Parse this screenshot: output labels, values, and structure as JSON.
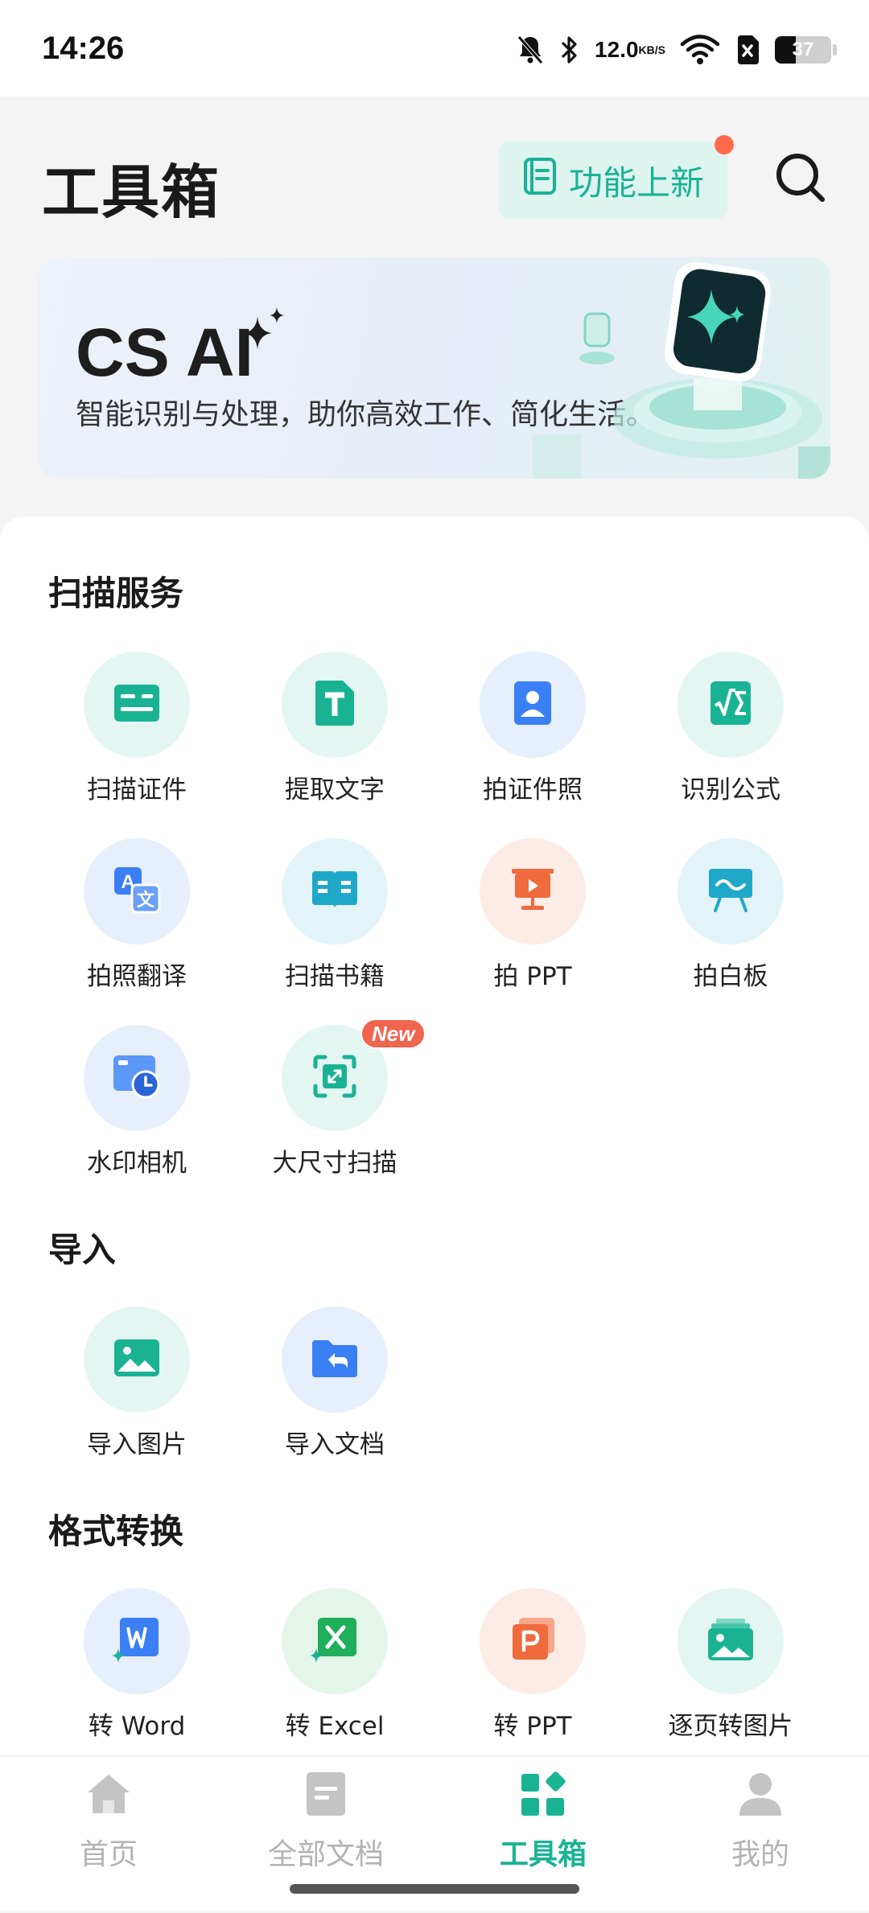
{
  "status_bar": {
    "time": "14:26",
    "net_speed_value": "12.0",
    "net_speed_unit": "KB/S",
    "battery_level": "37",
    "icons": [
      "mute-bell-icon",
      "bluetooth-icon",
      "wifi-icon",
      "sim-off-icon",
      "battery-icon"
    ]
  },
  "header": {
    "title": "工具箱",
    "new_feature_label": "功能上新",
    "search_icon": "search-icon"
  },
  "banner": {
    "title": "CS AI",
    "subtitle": "智能识别与处理，助你高效工作、简化生活。"
  },
  "sections": {
    "scan": {
      "title": "扫描服务",
      "items": [
        {
          "label": "扫描证件",
          "icon": "id-card-icon",
          "color": "#19b394",
          "bg": "#e4f6f2"
        },
        {
          "label": "提取文字",
          "icon": "text-extract-icon",
          "color": "#19b394",
          "bg": "#e4f6f2"
        },
        {
          "label": "拍证件照",
          "icon": "id-photo-icon",
          "color": "#3b7ff5",
          "bg": "#e7eefc"
        },
        {
          "label": "识别公式",
          "icon": "formula-icon",
          "color": "#19b394",
          "bg": "#e4f6f2"
        },
        {
          "label": "拍照翻译",
          "icon": "translate-icon",
          "color": "#3b7ff5",
          "bg": "#e7eefc"
        },
        {
          "label": "扫描书籍",
          "icon": "book-icon",
          "color": "#20a8c9",
          "bg": "#e3f4f8"
        },
        {
          "label": "拍 PPT",
          "icon": "ppt-projector-icon",
          "color": "#ef6a3c",
          "bg": "#fdebe6"
        },
        {
          "label": "拍白板",
          "icon": "whiteboard-icon",
          "color": "#20a8c9",
          "bg": "#e3f4f8"
        },
        {
          "label": "水印相机",
          "icon": "watermark-camera-icon",
          "color": "#3b7ff5",
          "bg": "#e7eefc"
        },
        {
          "label": "大尺寸扫描",
          "icon": "large-scan-icon",
          "color": "#19b394",
          "bg": "#e4f6f2",
          "badge": "New"
        }
      ]
    },
    "import": {
      "title": "导入",
      "items": [
        {
          "label": "导入图片",
          "icon": "image-import-icon",
          "color": "#19b394",
          "bg": "#e4f6f2"
        },
        {
          "label": "导入文档",
          "icon": "folder-import-icon",
          "color": "#3b7ff5",
          "bg": "#e7eefc"
        }
      ]
    },
    "convert": {
      "title": "格式转换",
      "items": [
        {
          "label": "转 Word",
          "icon": "word-icon",
          "color": "#3b7ff5",
          "bg": "#e7eefc"
        },
        {
          "label": "转 Excel",
          "icon": "excel-icon",
          "color": "#1fae5a",
          "bg": "#e4f6ea"
        },
        {
          "label": "转 PPT",
          "icon": "ppt-icon",
          "color": "#ef6a3c",
          "bg": "#fdebe6"
        },
        {
          "label": "逐页转图片",
          "icon": "pages-to-image-icon",
          "color": "#19b394",
          "bg": "#e4f6f2"
        }
      ]
    }
  },
  "tab_bar": {
    "tabs": [
      {
        "label": "首页",
        "icon": "home-icon"
      },
      {
        "label": "全部文档",
        "icon": "document-icon"
      },
      {
        "label": "工具箱",
        "icon": "toolbox-icon",
        "active": true
      },
      {
        "label": "我的",
        "icon": "profile-icon"
      }
    ]
  },
  "colors": {
    "accent": "#19b394",
    "badge_red": "#f0654d",
    "inactive": "#b3b3b3"
  }
}
